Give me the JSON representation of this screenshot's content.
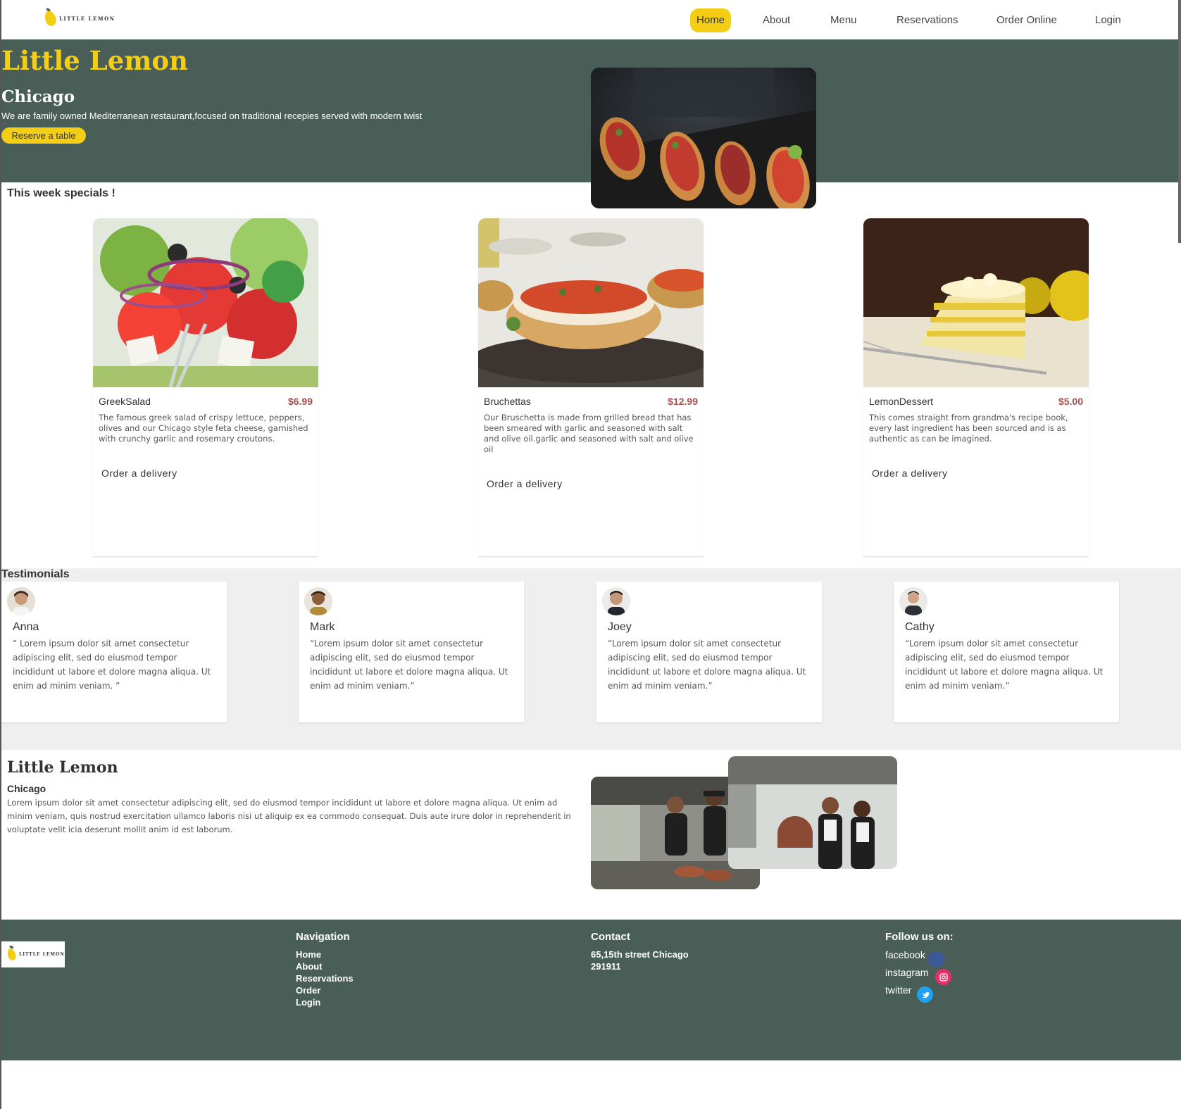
{
  "brand": {
    "logo_text": "LITTLE LEMON"
  },
  "nav": {
    "items": [
      {
        "label": "Home"
      },
      {
        "label": "About"
      },
      {
        "label": "Menu"
      },
      {
        "label": "Reservations"
      },
      {
        "label": "Order Online"
      },
      {
        "label": "Login"
      }
    ]
  },
  "hero": {
    "title": "Little Lemon",
    "city": "Chicago",
    "description": "We are family owned Mediterranean restaurant,focused on traditional recepies served with modern twist",
    "button": "Reserve a table"
  },
  "specials": {
    "title": "This week specials !",
    "items": [
      {
        "name": "GreekSalad",
        "price": "$6.99",
        "description": "The famous greek salad of crispy lettuce, peppers, olives and our Chicago style feta cheese, garnished with crunchy garlic and rosemary croutons.",
        "action": "Order a delivery"
      },
      {
        "name": "Bruchettas",
        "price": "$12.99",
        "description": "Our Bruschetta is made from grilled bread that has been smeared with garlic and seasoned with salt and olive oil.garlic and seasoned with salt and olive oil",
        "action": "Order a delivery"
      },
      {
        "name": "LemonDessert",
        "price": "$5.00",
        "description": "This comes straight from grandma's recipe book, every last ingredient has been sourced and is as authentic as can be imagined.",
        "action": "Order a delivery"
      }
    ]
  },
  "testimonials": {
    "title": "Testimonials",
    "items": [
      {
        "name": "Anna",
        "quote": "“ Lorem ipsum dolor sit amet consectetur adipiscing elit, sed do eiusmod tempor incididunt ut labore et dolore magna aliqua. Ut enim ad minim veniam. ”"
      },
      {
        "name": "Mark",
        "quote": "“Lorem ipsum dolor sit amet consectetur adipiscing elit, sed do eiusmod tempor incididunt ut labore et dolore magna aliqua. Ut enim ad minim veniam.”"
      },
      {
        "name": "Joey",
        "quote": "“Lorem ipsum dolor sit amet consectetur adipiscing elit, sed do eiusmod tempor incididunt ut labore et dolore magna aliqua. Ut enim ad minim veniam.”"
      },
      {
        "name": "Cathy",
        "quote": "“Lorem ipsum dolor sit amet consectetur adipiscing elit, sed do eiusmod tempor incididunt ut labore et dolore magna aliqua. Ut enim ad minim veniam.”"
      }
    ]
  },
  "about": {
    "title": "Little Lemon",
    "city": "Chicago",
    "text": "Lorem ipsum dolor sit amet consectetur adipiscing elit, sed do eiusmod tempor incididunt ut labore et dolore magna aliqua. Ut enim ad minim veniam, quis nostrud exercitation ullamco laboris nisi ut aliquip ex ea commodo consequat. Duis aute irure dolor in reprehenderit in voluptate velit icia deserunt mollit anim id est laborum."
  },
  "footer": {
    "navigation": {
      "title": "Navigation",
      "links": [
        "Home",
        "About",
        "Reservations",
        "Order",
        "Login"
      ]
    },
    "contact": {
      "title": "Contact",
      "lines": [
        "65,15th street Chicago",
        "291911"
      ]
    },
    "follow": {
      "title": "Follow us on:",
      "links": [
        {
          "label": "facebook",
          "icon": "facebook-icon",
          "color": "#3b5998"
        },
        {
          "label": "instagram",
          "icon": "instagram-icon",
          "color": "#e1306c"
        },
        {
          "label": "twitter",
          "icon": "twitter-icon",
          "color": "#1da1f2"
        }
      ]
    }
  },
  "colors": {
    "primary_green": "#495e57",
    "primary_yellow": "#f4ce14",
    "price_red": "#a05050",
    "testimonial_bg": "#eeefee"
  }
}
